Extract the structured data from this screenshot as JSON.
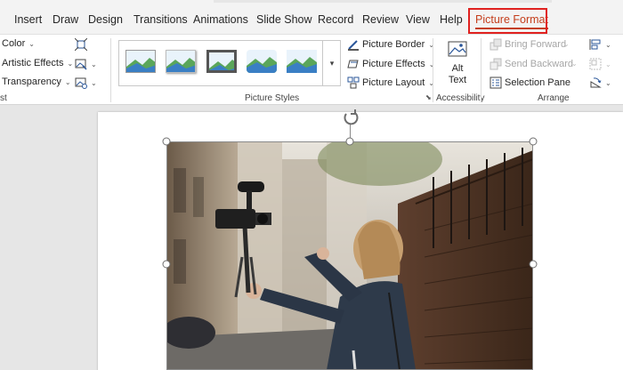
{
  "tabs": [
    {
      "label": "Insert",
      "active": false
    },
    {
      "label": "Draw",
      "active": false
    },
    {
      "label": "Design",
      "active": false
    },
    {
      "label": "Transitions",
      "active": false
    },
    {
      "label": "Animations",
      "active": false
    },
    {
      "label": "Slide Show",
      "active": false
    },
    {
      "label": "Record",
      "active": false
    },
    {
      "label": "Review",
      "active": false
    },
    {
      "label": "View",
      "active": false
    },
    {
      "label": "Help",
      "active": false
    },
    {
      "label": "Picture Format",
      "active": true
    }
  ],
  "ribbon": {
    "adjust": {
      "color": "Color",
      "artistic_effects": "Artistic Effects",
      "transparency": "Transparency",
      "label": "st"
    },
    "picture_styles": {
      "label": "Picture Styles",
      "picture_border": "Picture Border",
      "picture_effects": "Picture Effects",
      "picture_layout": "Picture Layout"
    },
    "accessibility": {
      "alt_text_line1": "Alt",
      "alt_text_line2": "Text",
      "label": "Accessibility"
    },
    "arrange": {
      "bring_forward": "Bring Forward",
      "send_backward": "Send Backward",
      "selection_pane": "Selection Pane",
      "label": "Arrange"
    }
  },
  "colors": {
    "accent": "#c43e1c",
    "highlight": "#e0211f"
  }
}
